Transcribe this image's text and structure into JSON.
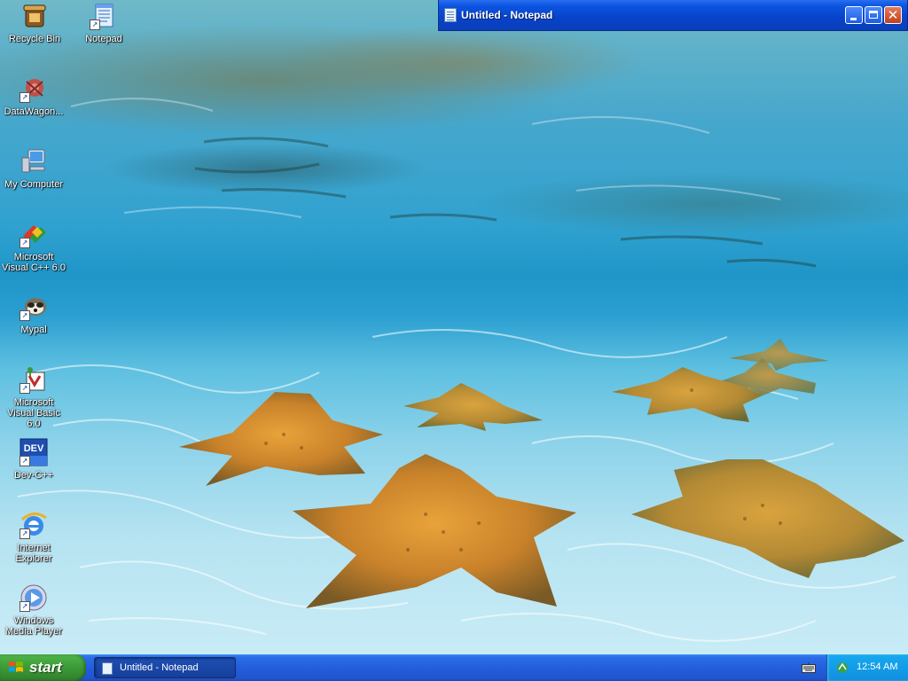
{
  "desktop": {
    "icons": [
      {
        "label": "Recycle Bin",
        "icon": "recycle-bin-icon"
      },
      {
        "label": "Notepad",
        "icon": "notepad-icon"
      },
      {
        "label": "DataWagon...",
        "icon": "datawagon-icon"
      },
      {
        "label": "My Computer",
        "icon": "my-computer-icon"
      },
      {
        "label": "Microsoft Visual C++ 6.0",
        "icon": "visual-cpp-icon"
      },
      {
        "label": "Mypal",
        "icon": "mypal-icon"
      },
      {
        "label": "Microsoft Visual Basic 6.0",
        "icon": "visual-basic-icon"
      },
      {
        "label": "Dev-C++",
        "icon": "dev-cpp-icon"
      },
      {
        "label": "Internet Explorer",
        "icon": "internet-explorer-icon"
      },
      {
        "label": "Windows Media Player",
        "icon": "windows-media-player-icon"
      }
    ],
    "dev_badge": "DEV"
  },
  "window": {
    "title": "Untitled - Notepad",
    "close_glyph": "✕"
  },
  "taskbar": {
    "start_label": "start",
    "task_button_label": "Untitled - Notepad",
    "clock": "12:54 AM"
  },
  "colors": {
    "title_bar": "#0b55e0",
    "taskbar": "#245edb",
    "start_button": "#3c9a37",
    "tray": "#0f8fe0"
  }
}
